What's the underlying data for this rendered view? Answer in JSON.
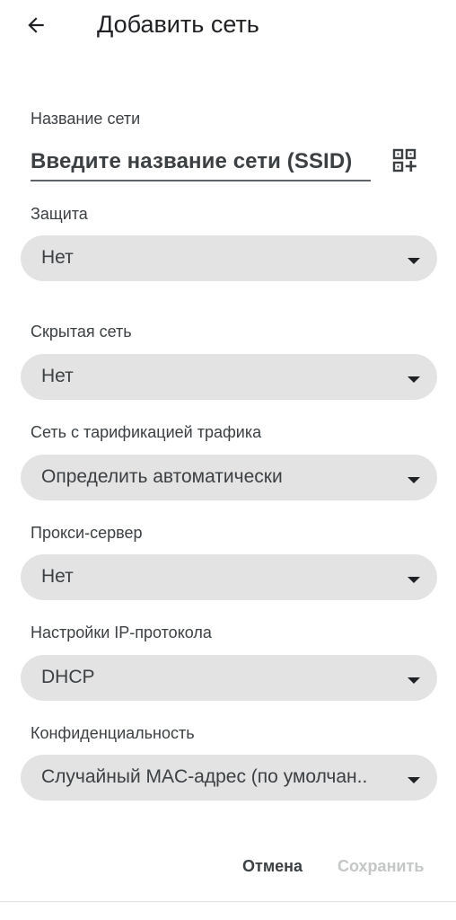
{
  "header": {
    "title": "Добавить сеть"
  },
  "ssid": {
    "label": "Название сети",
    "placeholder": "Введите название сети (SSID)"
  },
  "fields": [
    {
      "label": "Защита",
      "value": "Нет"
    },
    {
      "label": "Скрытая сеть",
      "value": "Нет"
    },
    {
      "label": "Сеть с тарификацией трафика",
      "value": "Определить автоматически"
    },
    {
      "label": "Прокси-сервер",
      "value": "Нет"
    },
    {
      "label": "Настройки IP-протокола",
      "value": "DHCP"
    },
    {
      "label": "Конфиденциальность",
      "value": "Случайный MAC-адрес (по умолчан.."
    }
  ],
  "actions": {
    "cancel_label": "Отмена",
    "save_label": "Сохранить"
  },
  "icons": {
    "back": "arrow-left-icon",
    "qr": "qr-code-add-icon",
    "dropdown": "dropdown-arrow-icon"
  },
  "colors": {
    "dropdown_bg": "#e3e3e3",
    "text": "#3c4043",
    "disabled": "#c4c7c5"
  }
}
